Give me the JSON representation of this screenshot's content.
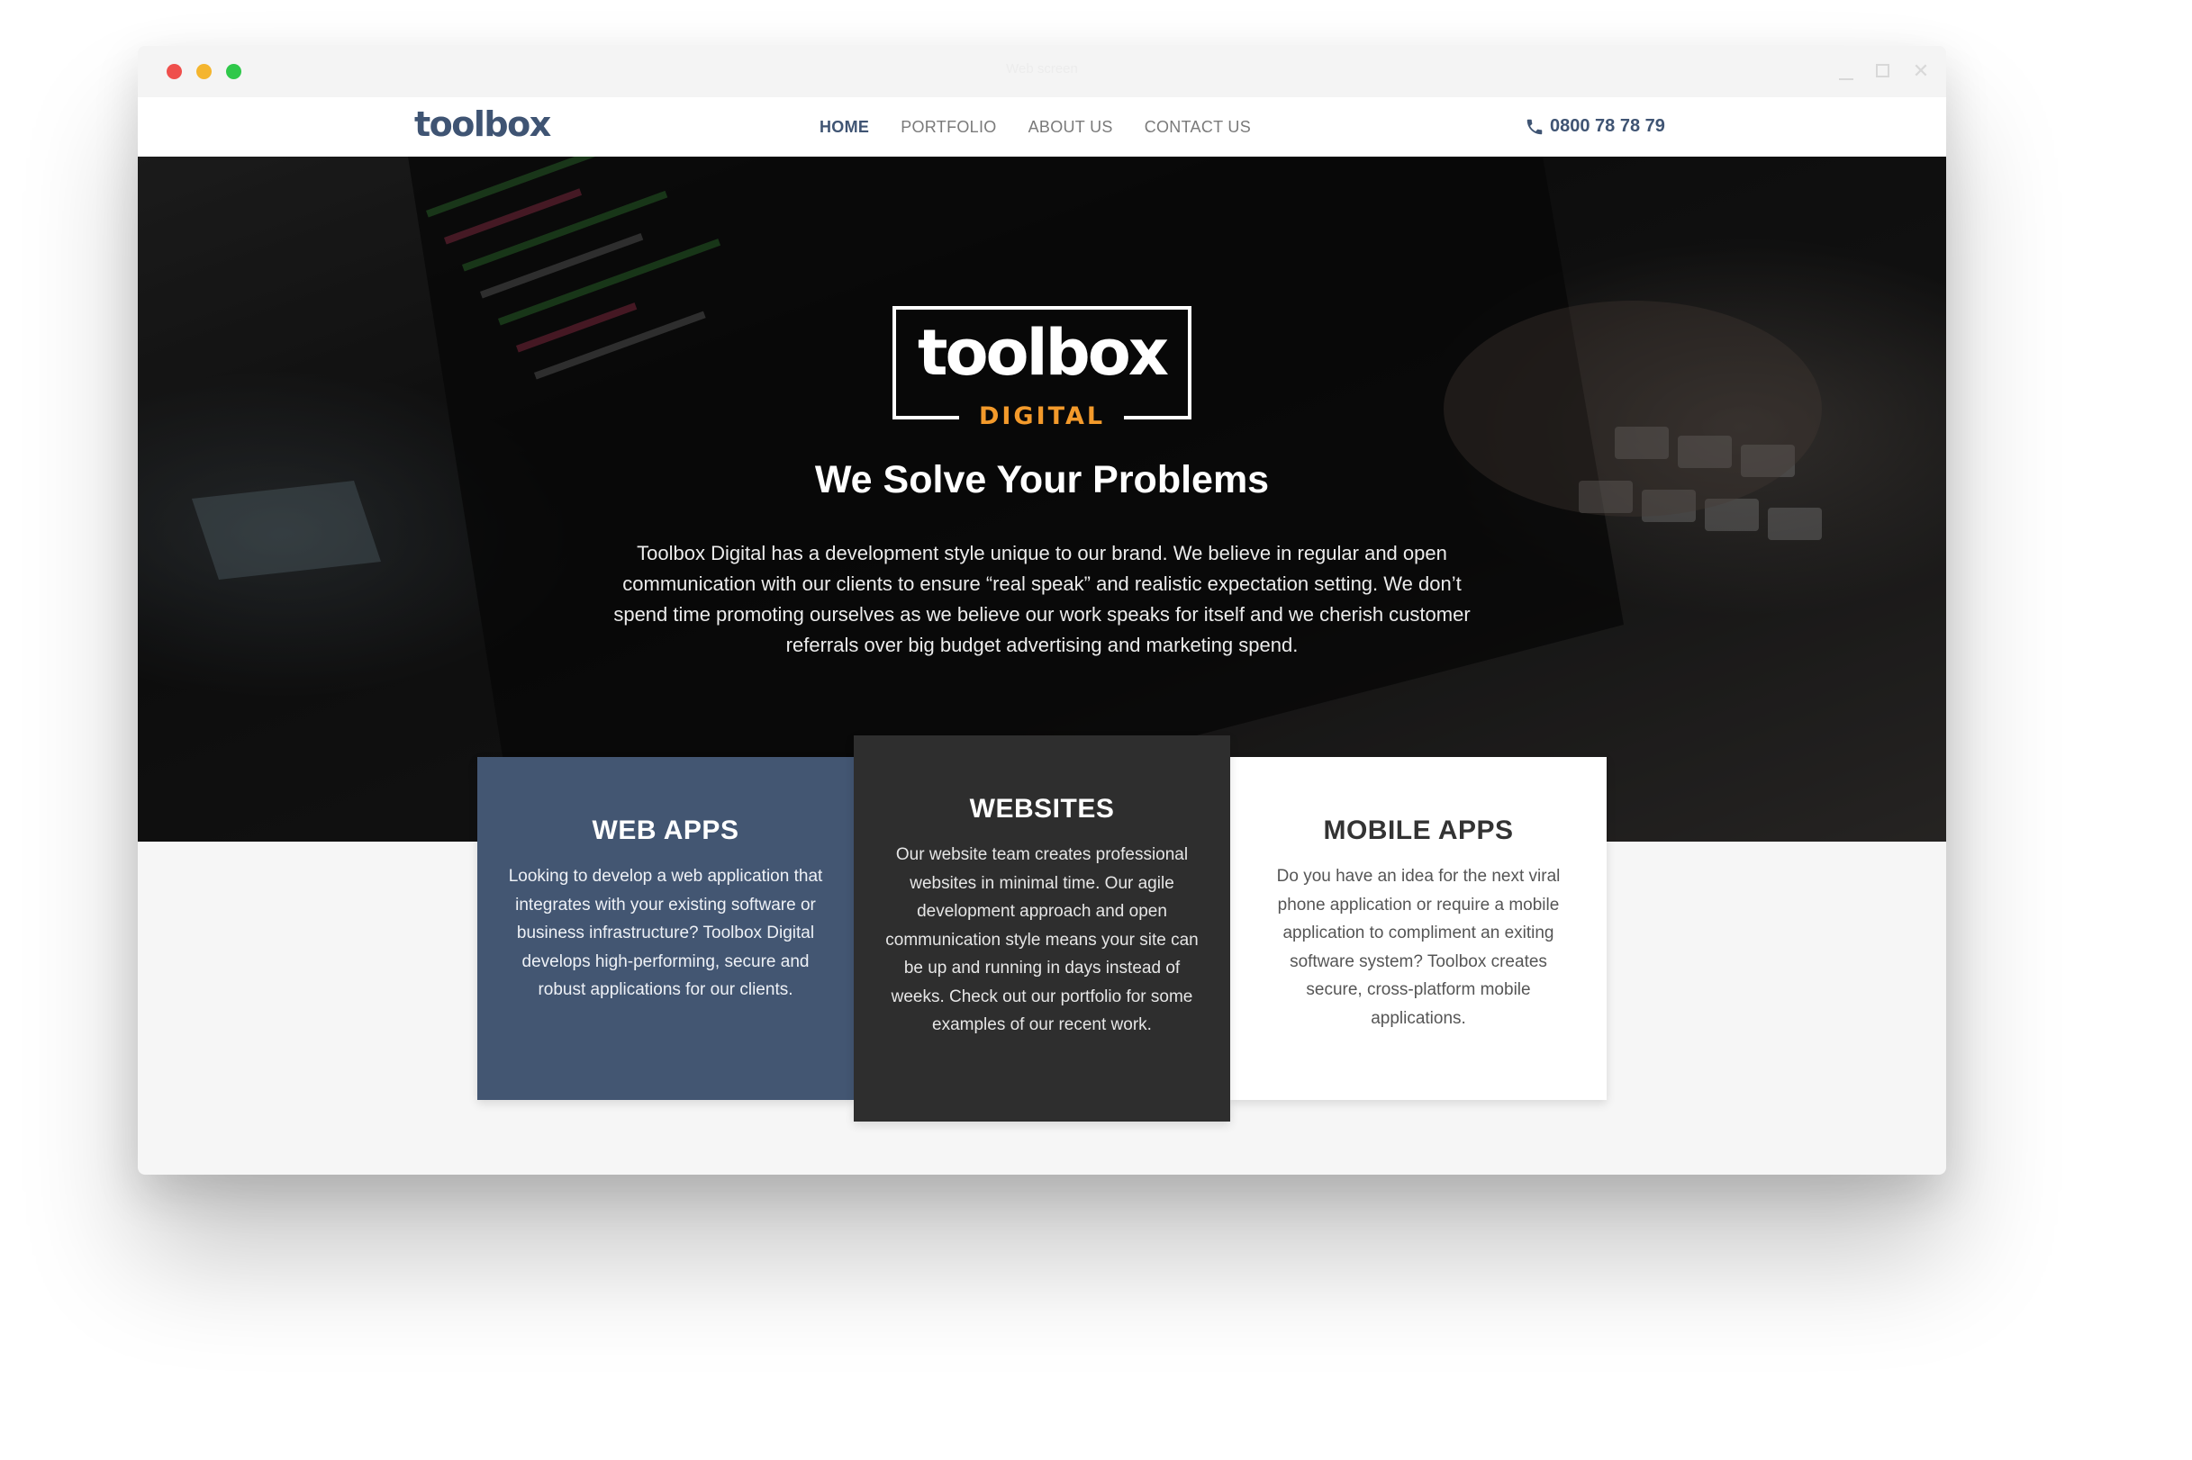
{
  "window": {
    "title": "Web screen"
  },
  "navbar": {
    "brand": "toolbox",
    "links": [
      {
        "label": "HOME",
        "active": true
      },
      {
        "label": "PORTFOLIO",
        "active": false
      },
      {
        "label": "ABOUT US",
        "active": false
      },
      {
        "label": "CONTACT US",
        "active": false
      }
    ],
    "phone_icon": "phone-icon",
    "phone": "0800 78 78 79"
  },
  "hero": {
    "logo_word": "toolbox",
    "logo_sub": "DIGITAL",
    "title": "We Solve Your Problems",
    "text": "Toolbox Digital has a development style unique to our brand. We believe in regular and open communication with our clients to ensure “real speak” and realistic expectation setting. We don’t spend time promoting ourselves as we believe our work speaks for itself and we cherish customer referrals over big budget advertising and marketing spend."
  },
  "cards": [
    {
      "title": "WEB APPS",
      "text": "Looking to develop a web application that integrates with your existing software or business infrastructure? Toolbox Digital develops high-performing, secure and robust applications for our clients."
    },
    {
      "title": "WEBSITES",
      "text": "Our website team creates professional websites in minimal time. Our agile development approach and open communication style means your site can be up and running in days instead of weeks. Check out our portfolio for some examples of our recent work."
    },
    {
      "title": "MOBILE APPS",
      "text": "Do you have an idea for the next viral phone application or require a mobile application to compliment an exiting software system? Toolbox creates secure, cross-platform mobile applications."
    }
  ],
  "colors": {
    "brand": "#3f5473",
    "accent": "#f39a2b",
    "card_web": "#435672",
    "card_sites": "#2e2e2e"
  }
}
